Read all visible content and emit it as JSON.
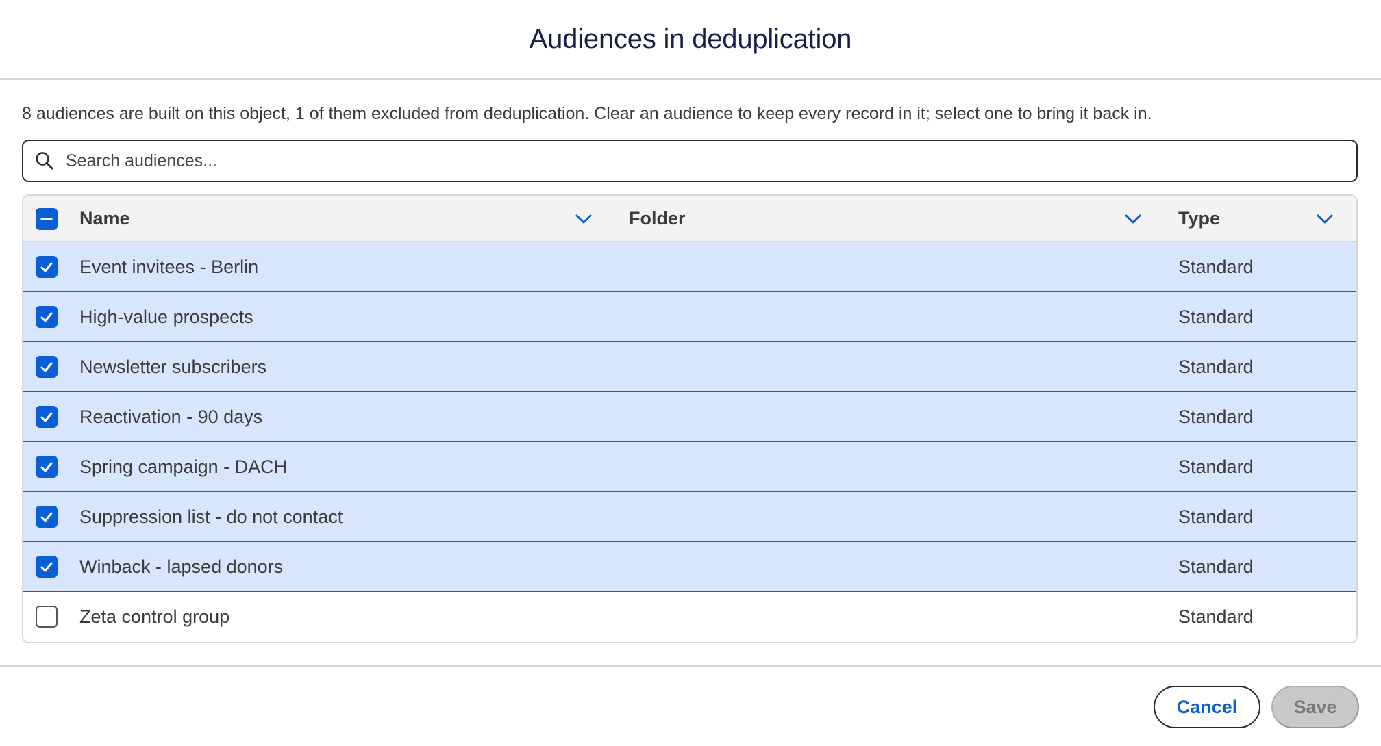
{
  "dialog": {
    "title": "Audiences in deduplication",
    "description": "8 audiences are built on this object, 1 of them excluded from deduplication. Clear an audience to keep every record in it; select one to bring it back in."
  },
  "search": {
    "placeholder": "Search audiences...",
    "value": ""
  },
  "table": {
    "columns": [
      {
        "label": "Name"
      },
      {
        "label": "Folder"
      },
      {
        "label": "Type"
      }
    ],
    "rows": [
      {
        "name": "Event invitees - Berlin",
        "folder": "",
        "type": "Standard",
        "selected": true
      },
      {
        "name": "High-value prospects",
        "folder": "",
        "type": "Standard",
        "selected": true
      },
      {
        "name": "Newsletter subscribers",
        "folder": "",
        "type": "Standard",
        "selected": true
      },
      {
        "name": "Reactivation - 90 days",
        "folder": "",
        "type": "Standard",
        "selected": true
      },
      {
        "name": "Spring campaign - DACH",
        "folder": "",
        "type": "Standard",
        "selected": true
      },
      {
        "name": "Suppression list - do not contact",
        "folder": "",
        "type": "Standard",
        "selected": true
      },
      {
        "name": "Winback - lapsed donors",
        "folder": "",
        "type": "Standard",
        "selected": true
      },
      {
        "name": "Zeta control group",
        "folder": "",
        "type": "Standard",
        "selected": false
      }
    ]
  },
  "footer": {
    "cancel_label": "Cancel",
    "save_label": "Save"
  },
  "colors": {
    "accent": "#0a5fd6",
    "selected_row": "#d8e6fd",
    "title": "#181f47"
  },
  "icons": {
    "search": "search-icon",
    "chevron": "chevron-down-icon",
    "check": "check-icon"
  }
}
